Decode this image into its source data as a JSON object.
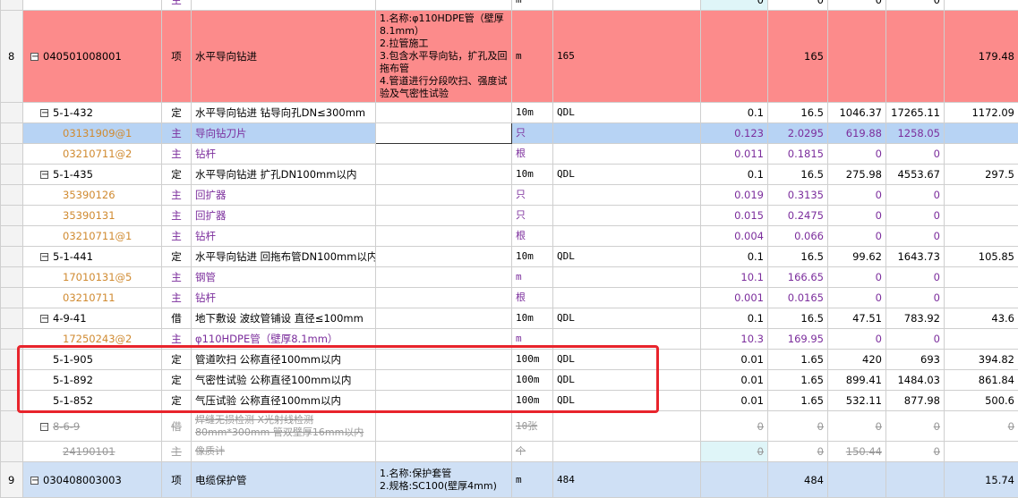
{
  "top_partial": {
    "cells": [
      "",
      "",
      "",
      "主",
      "",
      "",
      "m",
      "",
      "",
      "0",
      "0",
      "0",
      "0"
    ]
  },
  "rows": [
    {
      "idx": "8",
      "code": "040501008001",
      "type": "项",
      "name": "水平导向钻进",
      "desc": "1.名称:φ110HDPE管（壁厚8.1mm）\n2.拉管施工\n3.包含水平导向钻，扩孔及回拖布管\n4.管道进行分段吹扫、强度试验及气密性试验",
      "unit": "m",
      "expr": "165",
      "c1": "",
      "c2": "165",
      "c3": "",
      "c4": "",
      "c5": "179.48"
    },
    {
      "idx": "",
      "code": "5-1-432",
      "type": "定",
      "name": "水平导向钻进 钻导向孔DN≤300mm",
      "desc": "",
      "unit": "10m",
      "expr": "QDL",
      "c1": "0.1",
      "c2": "16.5",
      "c3": "1046.37",
      "c4": "17265.11",
      "c5": "1172.09"
    },
    {
      "idx": "",
      "code": "03131909@1",
      "type": "主",
      "name": "导向钻刀片",
      "desc": "",
      "unit": "只",
      "expr": "",
      "c1": "0.123",
      "c2": "2.0295",
      "c3": "619.88",
      "c4": "1258.05",
      "c5": ""
    },
    {
      "idx": "",
      "code": "03210711@2",
      "type": "主",
      "name": "钻杆",
      "desc": "",
      "unit": "根",
      "expr": "",
      "c1": "0.011",
      "c2": "0.1815",
      "c3": "0",
      "c4": "0",
      "c5": ""
    },
    {
      "idx": "",
      "code": "5-1-435",
      "type": "定",
      "name": "水平导向钻进 扩孔DN100mm以内",
      "desc": "",
      "unit": "10m",
      "expr": "QDL",
      "c1": "0.1",
      "c2": "16.5",
      "c3": "275.98",
      "c4": "4553.67",
      "c5": "297.5"
    },
    {
      "idx": "",
      "code": "35390126",
      "type": "主",
      "name": "回扩器",
      "desc": "",
      "unit": "只",
      "expr": "",
      "c1": "0.019",
      "c2": "0.3135",
      "c3": "0",
      "c4": "0",
      "c5": ""
    },
    {
      "idx": "",
      "code": "35390131",
      "type": "主",
      "name": "回扩器",
      "desc": "",
      "unit": "只",
      "expr": "",
      "c1": "0.015",
      "c2": "0.2475",
      "c3": "0",
      "c4": "0",
      "c5": ""
    },
    {
      "idx": "",
      "code": "03210711@1",
      "type": "主",
      "name": "钻杆",
      "desc": "",
      "unit": "根",
      "expr": "",
      "c1": "0.004",
      "c2": "0.066",
      "c3": "0",
      "c4": "0",
      "c5": ""
    },
    {
      "idx": "",
      "code": "5-1-441",
      "type": "定",
      "name": "水平导向钻进 回拖布管DN100mm以内",
      "desc": "",
      "unit": "10m",
      "expr": "QDL",
      "c1": "0.1",
      "c2": "16.5",
      "c3": "99.62",
      "c4": "1643.73",
      "c5": "105.85"
    },
    {
      "idx": "",
      "code": "17010131@5",
      "type": "主",
      "name": "钢管",
      "desc": "",
      "unit": "m",
      "expr": "",
      "c1": "10.1",
      "c2": "166.65",
      "c3": "0",
      "c4": "0",
      "c5": ""
    },
    {
      "idx": "",
      "code": "03210711",
      "type": "主",
      "name": "钻杆",
      "desc": "",
      "unit": "根",
      "expr": "",
      "c1": "0.001",
      "c2": "0.0165",
      "c3": "0",
      "c4": "0",
      "c5": ""
    },
    {
      "idx": "",
      "code": "4-9-41",
      "type": "借",
      "name": "地下敷设 波纹管铺设 直径≤100mm",
      "desc": "",
      "unit": "10m",
      "expr": "QDL",
      "c1": "0.1",
      "c2": "16.5",
      "c3": "47.51",
      "c4": "783.92",
      "c5": "43.6"
    },
    {
      "idx": "",
      "code": "17250243@2",
      "type": "主",
      "name": "φ110HDPE管（壁厚8.1mm）",
      "desc": "",
      "unit": "m",
      "expr": "",
      "c1": "10.3",
      "c2": "169.95",
      "c3": "0",
      "c4": "0",
      "c5": ""
    },
    {
      "idx": "",
      "code": "5-1-905",
      "type": "定",
      "name": "管道吹扫 公称直径100mm以内",
      "desc": "",
      "unit": "100m",
      "expr": "QDL",
      "c1": "0.01",
      "c2": "1.65",
      "c3": "420",
      "c4": "693",
      "c5": "394.82"
    },
    {
      "idx": "",
      "code": "5-1-892",
      "type": "定",
      "name": "气密性试验 公称直径100mm以内",
      "desc": "",
      "unit": "100m",
      "expr": "QDL",
      "c1": "0.01",
      "c2": "1.65",
      "c3": "899.41",
      "c4": "1484.03",
      "c5": "861.84"
    },
    {
      "idx": "",
      "code": "5-1-852",
      "type": "定",
      "name": "气压试验 公称直径100mm以内",
      "desc": "",
      "unit": "100m",
      "expr": "QDL",
      "c1": "0.01",
      "c2": "1.65",
      "c3": "532.11",
      "c4": "877.98",
      "c5": "500.6"
    },
    {
      "idx": "",
      "code": "8-6-9",
      "type": "借",
      "name": "焊缝无损检测 X光射线检测 80mm*300mm 管双壁厚16mm以内",
      "desc": "",
      "unit": "10张",
      "expr": "",
      "c1": "0",
      "c2": "0",
      "c3": "0",
      "c4": "0",
      "c5": "0"
    },
    {
      "idx": "",
      "code": "24190101",
      "type": "主",
      "name": "像质计",
      "desc": "",
      "unit": "个",
      "expr": "",
      "c1": "0",
      "c2": "0",
      "c3": "150.44",
      "c4": "0",
      "c5": ""
    },
    {
      "idx": "9",
      "code": "030408003003",
      "type": "项",
      "name": "电缆保护管",
      "desc": "1.名称:保护套管\n2.规格:SC100(壁厚4mm)",
      "unit": "m",
      "expr": "484",
      "c1": "",
      "c2": "484",
      "c3": "",
      "c4": "",
      "c5": "15.74"
    }
  ],
  "icons": {
    "collapse": "minus-box-icon"
  },
  "colors": {
    "item_row": "#fc8b8b",
    "selected_row": "#b7d3f4",
    "main_material": "#7b2d9c",
    "highlight_box": "#e8242c",
    "next_item_row": "#cfe0f5"
  }
}
